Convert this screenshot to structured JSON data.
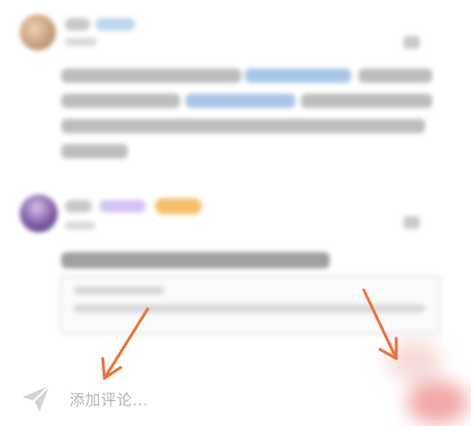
{
  "comment_input": {
    "placeholder": "添加评论..."
  },
  "icons": {
    "send": "send-icon",
    "like": "thumbs-up-icon"
  },
  "colors": {
    "annotation_arrow": "#e8733f",
    "link_text": "#a8c6e8",
    "verified_badge": "#f5c06a",
    "vip_badge": "#c9b6f2",
    "submit_button": "#f29999"
  }
}
